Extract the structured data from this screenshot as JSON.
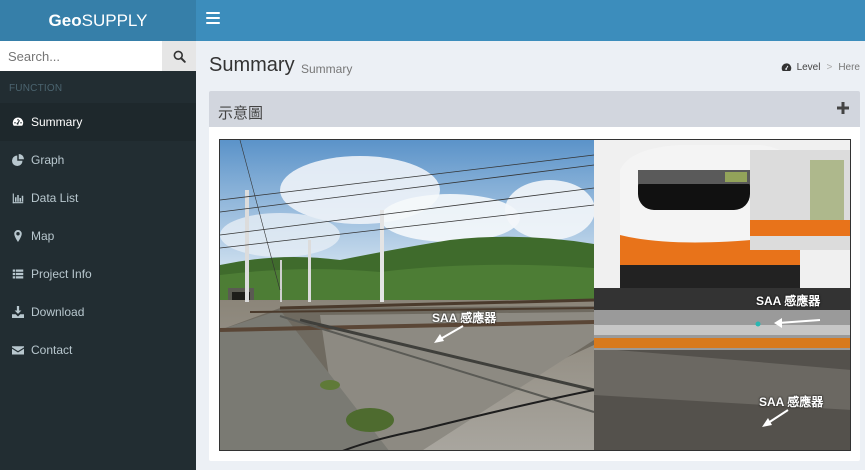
{
  "header": {
    "logo_bold": "Geo",
    "logo_rest": "SUPPLY",
    "toggle_icon": "bars-icon",
    "colors": {
      "logo_bg": "#367fa9",
      "bar_bg": "#3c8dbc",
      "sidebar_bg": "#222d32"
    }
  },
  "sidebar": {
    "search_placeholder": "Search...",
    "search_icon": "search-icon",
    "section_label": "FUNCTION",
    "items": [
      {
        "label": "Summary",
        "icon": "dashboard-icon",
        "active": true
      },
      {
        "label": "Graph",
        "icon": "pie-chart-icon",
        "active": false
      },
      {
        "label": "Data List",
        "icon": "bar-chart-icon",
        "active": false
      },
      {
        "label": "Map",
        "icon": "map-marker-icon",
        "active": false
      },
      {
        "label": "Project Info",
        "icon": "list-icon",
        "active": false
      },
      {
        "label": "Download",
        "icon": "download-icon",
        "active": false
      },
      {
        "label": "Contact",
        "icon": "envelope-icon",
        "active": false
      }
    ]
  },
  "content": {
    "title": "Summary",
    "subtitle": "Summary",
    "breadcrumb": {
      "level": "Level",
      "here": "Here"
    }
  },
  "box": {
    "title": "示意圖",
    "tool_icon": "plus-icon",
    "labels": {
      "left": "SAA 感應器",
      "right_top": "SAA 感應器",
      "right_bottom": "SAA 感應器"
    }
  }
}
